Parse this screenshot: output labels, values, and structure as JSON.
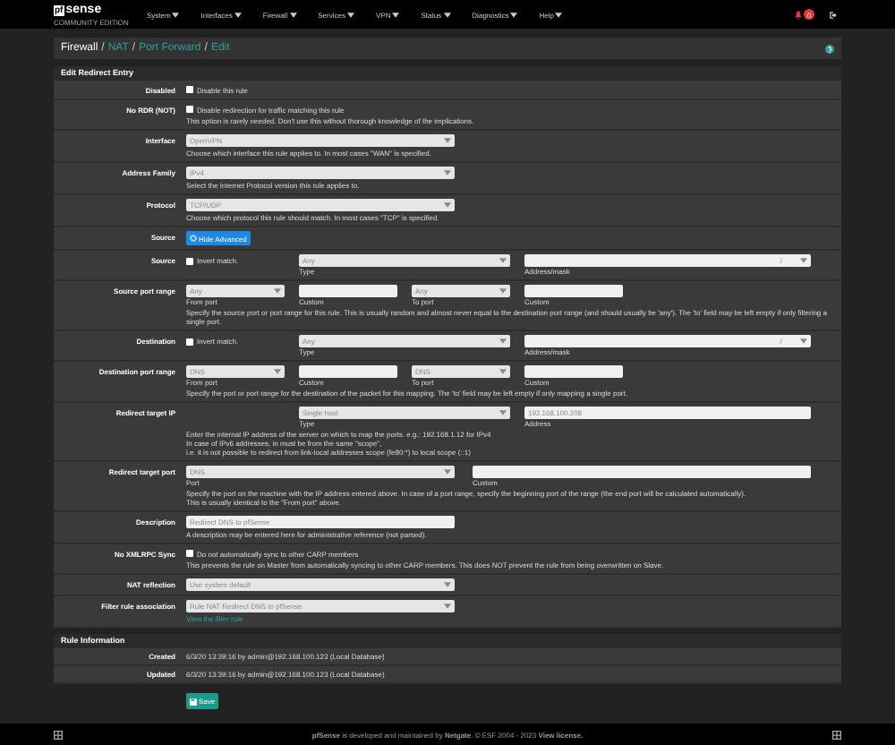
{
  "navbar": {
    "logo": {
      "mark": "pf",
      "name": "sense",
      "edition": "COMMUNITY EDITION"
    },
    "menus": [
      "System",
      "Interfaces",
      "Firewall",
      "Services",
      "VPN",
      "Status",
      "Diagnostics",
      "Help"
    ],
    "badge": "0"
  },
  "breadcrumb": [
    {
      "text": "Firewall",
      "link": false,
      "separator": "/"
    },
    {
      "text": "NAT",
      "link": true,
      "separator": "/"
    },
    {
      "text": "Port Forward",
      "link": true,
      "separator": "/"
    },
    {
      "text": "Edit",
      "link": true
    }
  ],
  "edit": {
    "title": "Edit Redirect Entry",
    "rows": [
      {
        "kind": "checkbox",
        "label": "Disabled",
        "checkbox": {
          "checked": false,
          "text": "Disable this rule"
        }
      },
      {
        "kind": "checkbox",
        "label": "No RDR (NOT)",
        "checkbox": {
          "checked": false,
          "text": "Disable redirection for traffic matching this rule"
        },
        "help": [
          "This option is rarely needed. Don't use this without thorough knowledge of the implications."
        ]
      },
      {
        "kind": "select",
        "label": "Interface",
        "select": "OpenVPN",
        "help": [
          "Choose which interface this rule applies to. In most cases \"WAN\" is specified."
        ]
      },
      {
        "kind": "select",
        "label": "Address Family",
        "select": "IPv4",
        "help": [
          "Select the Internet Protocol version this rule applies to."
        ]
      },
      {
        "kind": "select",
        "label": "Protocol",
        "select": "TCP/UDP",
        "help": [
          "Choose which protocol this rule should match. In most cases \"TCP\" is specified."
        ]
      },
      {
        "kind": "button",
        "label": "Source",
        "button": "Hide Advanced"
      },
      {
        "kind": "match",
        "label": "Source",
        "invert": {
          "checked": false,
          "text": "Invert match."
        },
        "type": {
          "value": "Any",
          "caption": "Type"
        },
        "address": {
          "mask": "/",
          "caption": "Address/mask"
        }
      },
      {
        "kind": "ports",
        "label": "Source port range",
        "fields": [
          {
            "kind": "select",
            "value": "Any",
            "caption": "From port"
          },
          {
            "kind": "input",
            "caption": "Custom"
          },
          {
            "kind": "select",
            "value": "Any",
            "caption": "To port"
          },
          {
            "kind": "input",
            "caption": "Custom"
          }
        ],
        "help": [
          "Specify the source port or port range for this rule. This is usually random and almost never equal to the destination port range (and should usually be 'any'). The 'to' field may be left empty if only filtering a single port."
        ]
      },
      {
        "kind": "match",
        "label": "Destination",
        "invert": {
          "checked": false,
          "text": "Invert match."
        },
        "type": {
          "value": "Any",
          "caption": "Type"
        },
        "address": {
          "mask": "/",
          "caption": "Address/mask"
        }
      },
      {
        "kind": "ports",
        "label": "Destination port range",
        "fields": [
          {
            "kind": "select",
            "value": "DNS",
            "caption": "From port"
          },
          {
            "kind": "input",
            "caption": "Custom"
          },
          {
            "kind": "select",
            "value": "DNS",
            "caption": "To port"
          },
          {
            "kind": "input",
            "caption": "Custom"
          }
        ],
        "help": [
          "Specify the port or port range for the destination of the packet for this mapping. The 'to' field may be left empty if only mapping a single port."
        ]
      },
      {
        "kind": "target",
        "label": "Redirect target IP",
        "type": {
          "value": "Single host",
          "caption": "Type"
        },
        "address": {
          "value": "192.168.100.208",
          "caption": "Address"
        },
        "help": [
          "Enter the internal IP address of the server on which to map the ports. e.g.: 192.168.1.12 for IPv4",
          "In case of IPv6 addresses, in must be from the same \"scope\",",
          "i.e. it is not possible to redirect from link-local addresses scope (fe80:*) to local scope (::1)"
        ]
      },
      {
        "kind": "port",
        "label": "Redirect target port",
        "select": {
          "value": "DNS",
          "caption": "Port"
        },
        "custom": {
          "caption": "Custom"
        },
        "help": [
          "Specify the port on the machine with the IP address entered above. In case of a port range, specify the beginning port of the range (the end port will be calculated automatically).",
          "This is usually identical to the \"From port\" above."
        ]
      },
      {
        "kind": "input",
        "label": "Description",
        "value": "Redirect DNS to pfSense",
        "help": [
          "A description may be entered here for administrative reference (not parsed)."
        ]
      },
      {
        "kind": "checkbox",
        "label": "No XMLRPC Sync",
        "checkbox": {
          "checked": false,
          "text": "Do not automatically sync to other CARP members"
        },
        "help": [
          "This prevents the rule on Master from automatically syncing to other CARP members. This does NOT prevent the rule from being overwritten on Slave."
        ]
      },
      {
        "kind": "select",
        "label": "NAT reflection",
        "select": "Use system default"
      },
      {
        "kind": "select",
        "label": "Filter rule association",
        "select": "Rule NAT Redirect DNS to pfSense",
        "link": "View the filter rule"
      }
    ]
  },
  "rule_info": {
    "title": "Rule Information",
    "rows": [
      {
        "label": "Created",
        "value": "6/3/20 13:39:16 by admin@192.168.100.123 (Local Database)"
      },
      {
        "label": "Updated",
        "value": "6/3/20 13:39:16 by admin@192.168.100.123 (Local Database)"
      }
    ]
  },
  "save_button": "Save",
  "footer": "**pfSense** is developed and maintained by **Netgate**. © ESF 2004 - 2023 **View license.**"
}
